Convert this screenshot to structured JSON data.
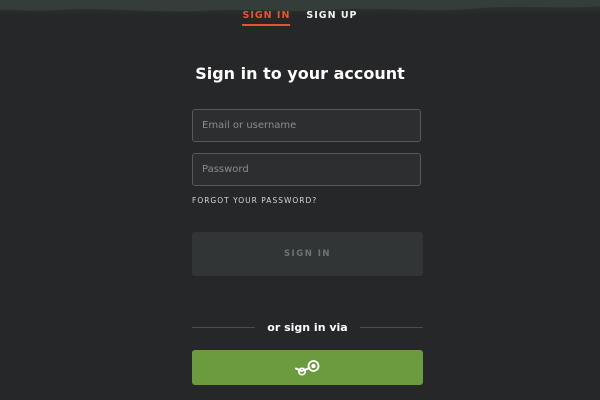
{
  "tabs": [
    {
      "label": "SIGN IN",
      "active": true
    },
    {
      "label": "SIGN UP",
      "active": false
    }
  ],
  "form": {
    "title": "Sign in to your account",
    "email_placeholder": "Email or username",
    "password_placeholder": "Password",
    "forgot_label": "FORGOT YOUR PASSWORD?",
    "submit_label": "SIGN IN"
  },
  "social": {
    "divider_label": "or sign in via",
    "steam_icon": "steam-icon"
  },
  "colors": {
    "background": "#262728",
    "accent": "#e4572e",
    "steam_green": "#6b9a3f"
  }
}
